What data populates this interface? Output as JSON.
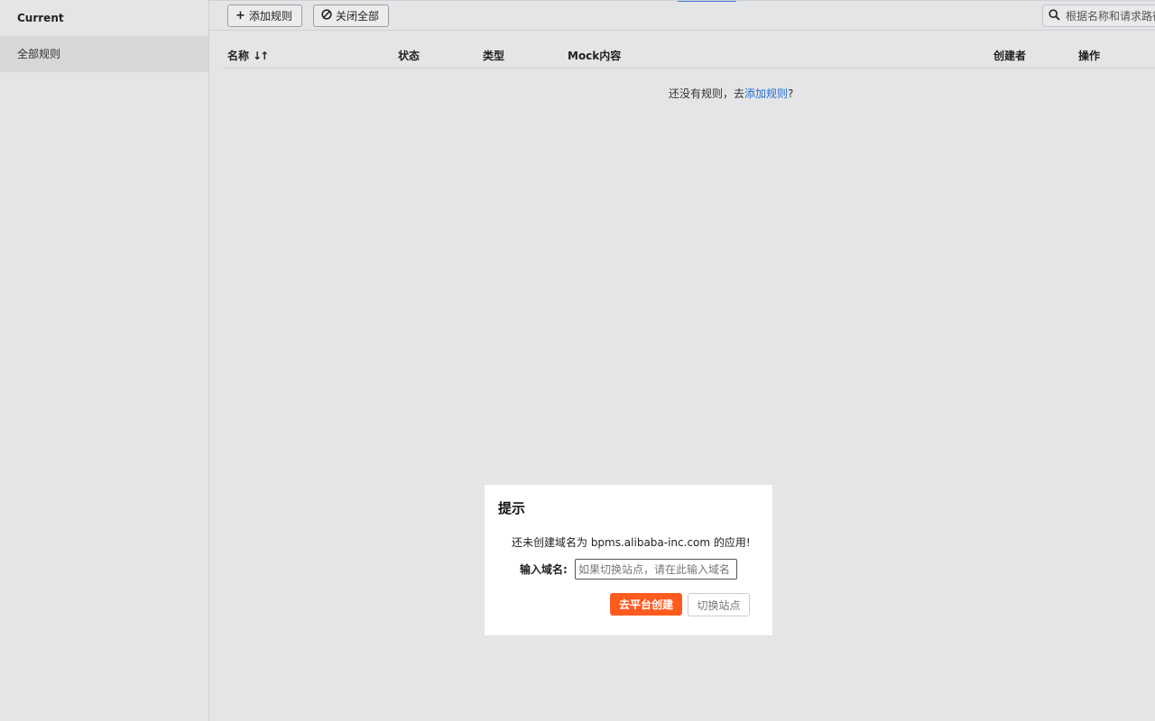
{
  "sidebar": {
    "header": "Current",
    "items": [
      {
        "label": "全部规则"
      }
    ]
  },
  "toolbar": {
    "add_rule_label": "添加规则",
    "add_rule_icon": "plus-icon",
    "close_all_label": "关闭全部",
    "close_all_icon": "ban-icon",
    "search_placeholder": "根据名称和请求路径搜索",
    "search_icon": "search-icon"
  },
  "table": {
    "columns": [
      {
        "label": "名称"
      },
      {
        "label": "状态"
      },
      {
        "label": "类型"
      },
      {
        "label": "Mock内容"
      },
      {
        "label": "创建者"
      },
      {
        "label": "操作"
      }
    ],
    "sort_icon": "sort-icon",
    "empty_prefix": "还没有规则，去",
    "empty_link": "添加规则",
    "empty_suffix": "?"
  },
  "dialog": {
    "title": "提示",
    "message": "还未创建域名为 bpms.alibaba-inc.com 的应用!",
    "input_label": "输入域名:",
    "input_placeholder": "如果切换站点，请在此输入域名",
    "primary_button": "去平台创建",
    "secondary_button": "切换站点"
  },
  "colors": {
    "background": "#e4e5e7",
    "accent": "#ff5b1f",
    "link": "#2a6fd1"
  }
}
